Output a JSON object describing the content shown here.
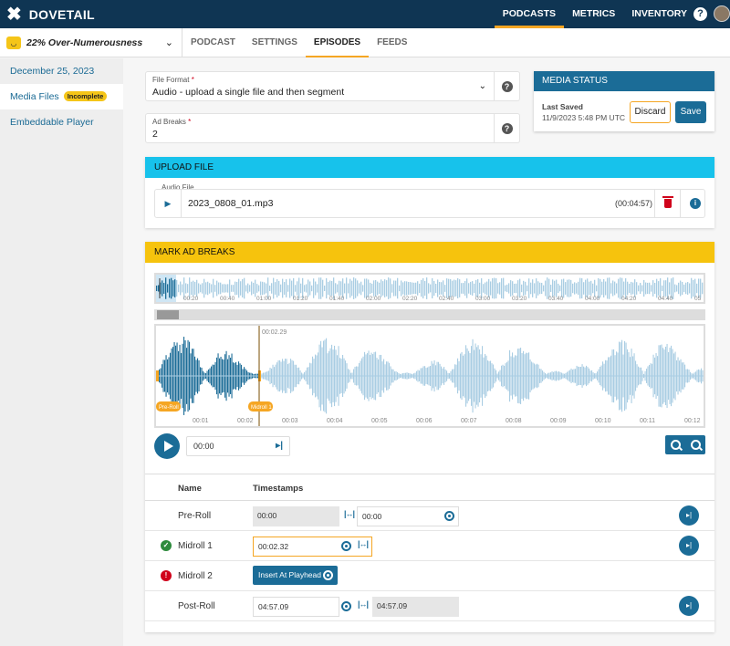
{
  "brand": {
    "name": "DOVETAIL"
  },
  "topnav": {
    "items": [
      "PODCASTS",
      "METRICS",
      "INVENTORY"
    ],
    "active": "PODCASTS",
    "help": "?"
  },
  "podcast": {
    "name": "22% Over-Numerousness"
  },
  "tabs": {
    "items": [
      "PODCAST",
      "SETTINGS",
      "EPISODES",
      "FEEDS"
    ],
    "active": "EPISODES"
  },
  "sidebar": {
    "items": [
      {
        "label": "December 25, 2023"
      },
      {
        "label": "Media Files",
        "badge": "Incomplete"
      },
      {
        "label": "Embeddable Player"
      }
    ]
  },
  "form": {
    "file_format": {
      "label": "File Format",
      "value": "Audio - upload a single file and then segment"
    },
    "ad_breaks": {
      "label": "Ad Breaks",
      "value": "2"
    },
    "required_mark": "*"
  },
  "media_status": {
    "title": "MEDIA STATUS",
    "last_saved_label": "Last Saved",
    "last_saved_time": "11/9/2023 5:48 PM UTC",
    "discard_label": "Discard",
    "save_label": "Save"
  },
  "upload": {
    "title": "UPLOAD FILE",
    "audio_label": "Audio File",
    "file_name": "2023_0808_01.mp3",
    "duration": "(00:04:57)"
  },
  "ad_breaks": {
    "title": "MARK AD BREAKS",
    "overview_ticks": [
      "00:20",
      "00:40",
      "01:00",
      "01:20",
      "01:40",
      "02:00",
      "02:20",
      "02:40",
      "03:00",
      "03:20",
      "03:40",
      "04:00",
      "04:20",
      "04:40",
      "05"
    ],
    "zoom_ticks": [
      "00:01",
      "00:02",
      "00:03",
      "00:04",
      "00:05",
      "00:06",
      "00:07",
      "00:08",
      "00:09",
      "00:10",
      "00:11",
      "00:12"
    ],
    "playhead_time": "00:02.29",
    "markers": [
      "Pre-Roll",
      "Midroll 1"
    ],
    "transport_time": "00:00",
    "columns": [
      "Name",
      "Timestamps"
    ],
    "rows": [
      {
        "name": "Pre-Roll",
        "start": "00:00",
        "end": "00:00",
        "status": ""
      },
      {
        "name": "Midroll 1",
        "start": "00:02.32",
        "status": "ok"
      },
      {
        "name": "Midroll 2",
        "insert_label": "Insert At Playhead",
        "status": "error"
      },
      {
        "name": "Post-Roll",
        "start": "04:57.09",
        "end": "04:57.09",
        "status": ""
      }
    ]
  },
  "colors": {
    "nav": "#0f3553",
    "accent": "#f5a623",
    "primary": "#1b6c97",
    "upload": "#17c2eb",
    "adbreaks": "#f6c30d",
    "wave_dark": "#1b6c97",
    "wave_light": "#a9cde3"
  }
}
